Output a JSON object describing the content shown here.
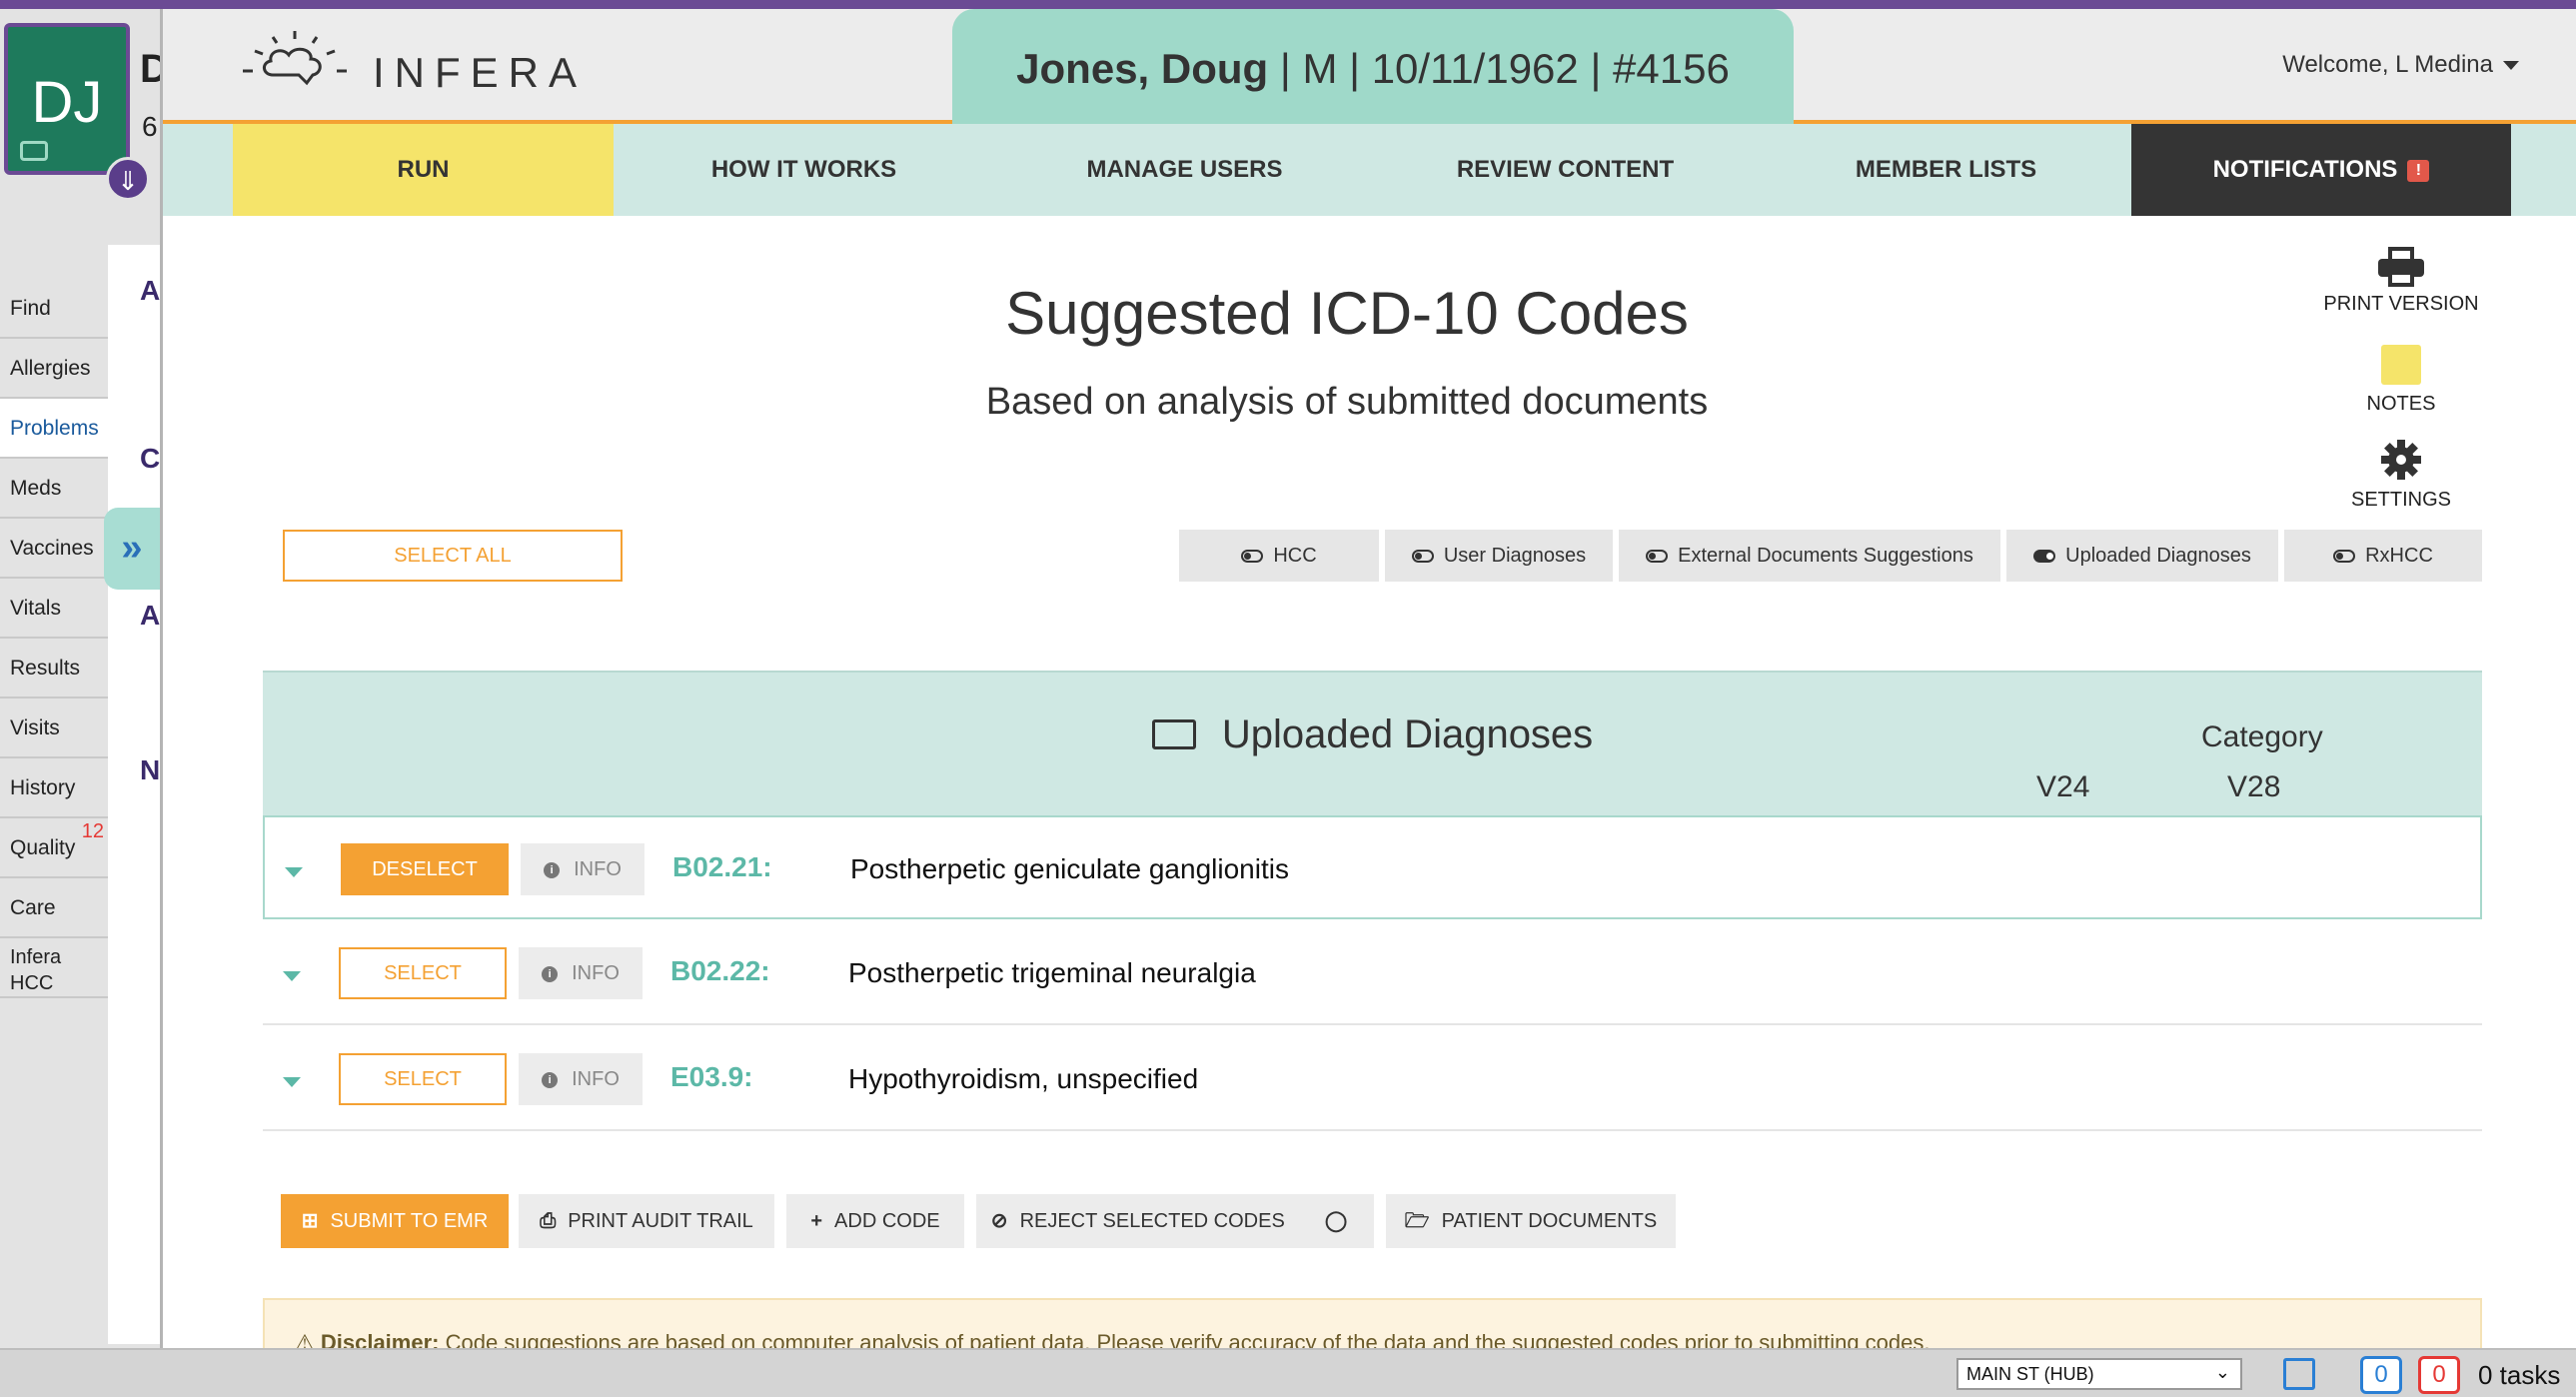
{
  "emr": {
    "avatar_initials": "DJ",
    "patient_initial": "D",
    "patient_age_fragment": "6",
    "nav": [
      {
        "label": "Find"
      },
      {
        "label": "Allergies"
      },
      {
        "label": "Problems"
      },
      {
        "label": "Meds"
      },
      {
        "label": "Vaccines"
      },
      {
        "label": "Vitals"
      },
      {
        "label": "Results"
      },
      {
        "label": "Visits"
      },
      {
        "label": "History"
      },
      {
        "label": "Quality",
        "badge": "12"
      },
      {
        "label": "Care"
      },
      {
        "label": "Infera HCC"
      }
    ],
    "content_letters": [
      "A",
      "C",
      "A",
      "N"
    ],
    "expand_icon": "»"
  },
  "header": {
    "logo_text": "INFERA",
    "patient_name": "Jones, Doug",
    "patient_details": "| M | 10/11/1962 | #4156",
    "welcome": "Welcome, L Medina"
  },
  "nav": {
    "tabs": [
      {
        "label": "RUN",
        "active": true
      },
      {
        "label": "HOW IT WORKS"
      },
      {
        "label": "MANAGE USERS"
      },
      {
        "label": "REVIEW CONTENT"
      },
      {
        "label": "MEMBER LISTS"
      },
      {
        "label": "NOTIFICATIONS",
        "icon": "alert-flag-icon"
      }
    ]
  },
  "page": {
    "title": "Suggested ICD-10 Codes",
    "subtitle": "Based on analysis of submitted documents"
  },
  "tools": {
    "print": "PRINT VERSION",
    "notes": "NOTES",
    "settings": "SETTINGS"
  },
  "controls": {
    "select_all": "SELECT ALL",
    "filters": [
      {
        "label": "HCC",
        "on": false
      },
      {
        "label": "User Diagnoses",
        "on": false
      },
      {
        "label": "External Documents Suggestions",
        "on": false
      },
      {
        "label": "Uploaded Diagnoses",
        "on": true
      },
      {
        "label": "RxHCC",
        "on": false
      }
    ]
  },
  "section": {
    "title": "Uploaded Diagnoses",
    "category_label": "Category",
    "col_v24": "V24",
    "col_v28": "V28"
  },
  "diagnoses": [
    {
      "action": "DESELECT",
      "info": "INFO",
      "code": "B02.21:",
      "description": "Postherpetic geniculate ganglionitis",
      "selected": true
    },
    {
      "action": "SELECT",
      "info": "INFO",
      "code": "B02.22:",
      "description": "Postherpetic trigeminal neuralgia",
      "selected": false
    },
    {
      "action": "SELECT",
      "info": "INFO",
      "code": "E03.9:",
      "description": "Hypothyroidism, unspecified",
      "selected": false
    }
  ],
  "actions": {
    "submit": "SUBMIT TO EMR",
    "print_audit": "PRINT AUDIT TRAIL",
    "add_code": "ADD CODE",
    "reject": "REJECT SELECTED CODES",
    "documents": "PATIENT DOCUMENTS"
  },
  "disclaimer": {
    "label": "Disclaimer:",
    "text": "Code suggestions are based on computer analysis of patient data. Please verify accuracy of the data and the suggested codes prior to submitting codes."
  },
  "status": {
    "location": "MAIN ST (HUB)",
    "count_blue": "0",
    "count_red": "0",
    "tasks": "0 tasks"
  },
  "colors": {
    "accent_orange": "#f4a133",
    "teal": "#9fd9c9",
    "code_teal": "#5cb8a7",
    "run_yellow": "#f5e46a",
    "emr_purple": "#6b4a94"
  }
}
